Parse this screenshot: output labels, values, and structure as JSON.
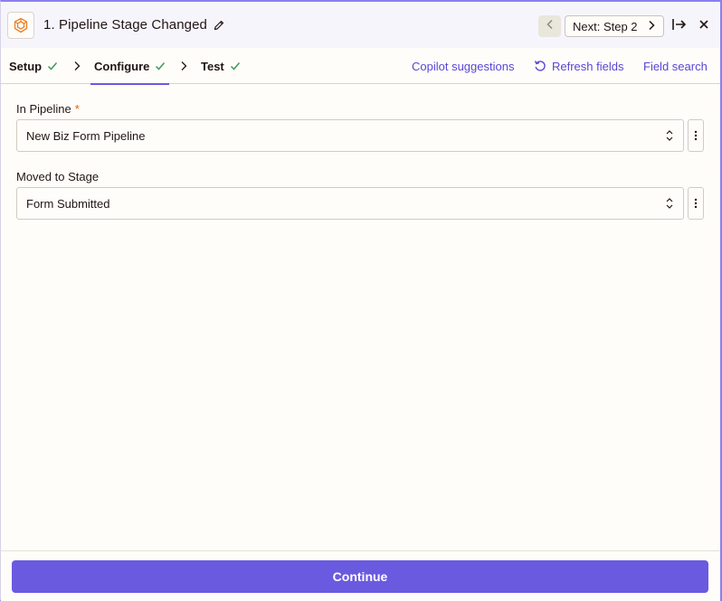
{
  "header": {
    "title": "1. Pipeline Stage Changed",
    "next_label": "Next: Step 2"
  },
  "tabs": [
    {
      "label": "Setup",
      "complete": true,
      "active": false
    },
    {
      "label": "Configure",
      "complete": true,
      "active": true
    },
    {
      "label": "Test",
      "complete": true,
      "active": false
    }
  ],
  "actions": {
    "copilot": "Copilot suggestions",
    "refresh": "Refresh fields",
    "field_search": "Field search"
  },
  "fields": [
    {
      "label": "In Pipeline",
      "required": true,
      "required_mark": "*",
      "value": "New Biz Form Pipeline"
    },
    {
      "label": "Moved to Stage",
      "required": false,
      "value": "Form Submitted"
    }
  ],
  "footer": {
    "continue_label": "Continue"
  },
  "colors": {
    "accent": "#6a5ae0",
    "link": "#5846d8",
    "check": "#3d9a5c",
    "required": "#d9620c",
    "app_icon": "#e8842c"
  },
  "icons": [
    "app-logo-icon",
    "pencil-icon",
    "chevron-left-icon",
    "chevron-right-icon",
    "collapse-arrow-icon",
    "close-icon",
    "check-icon",
    "refresh-icon",
    "select-arrows-icon",
    "kebab-menu-icon"
  ]
}
